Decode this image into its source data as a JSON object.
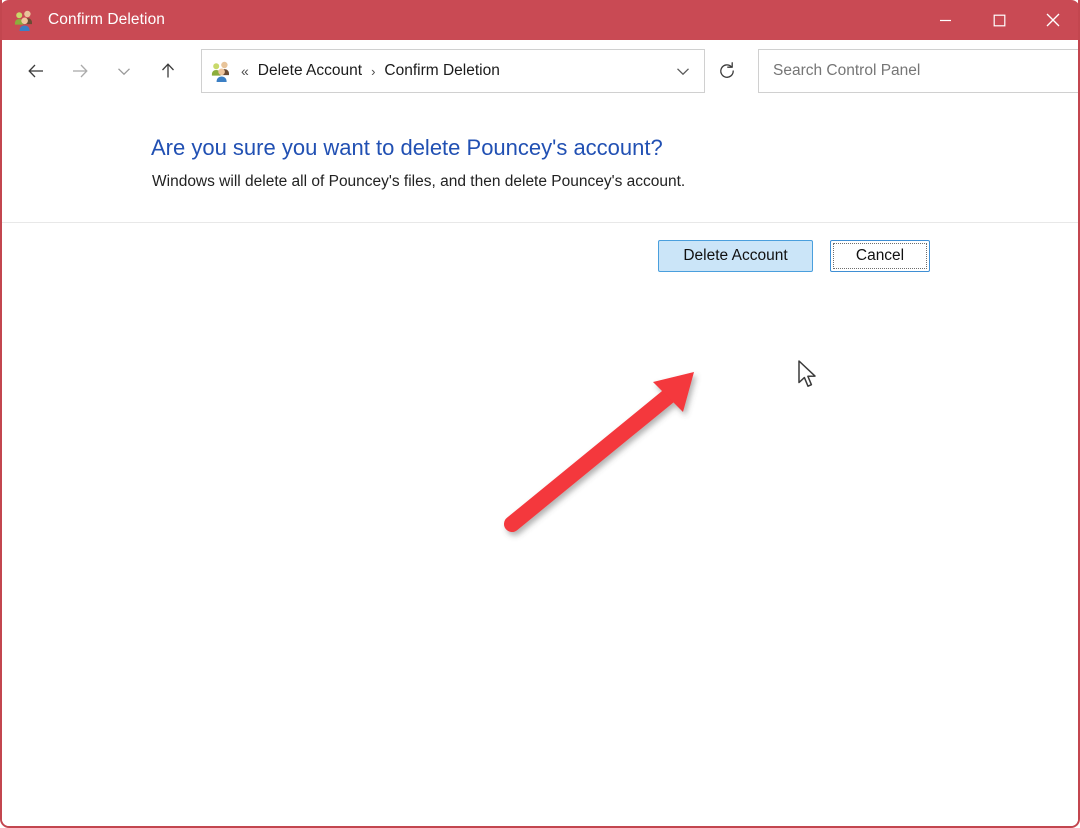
{
  "window": {
    "title": "Confirm Deletion",
    "title_icon": "user-accounts-icon",
    "titlebar_color": "#c94a54",
    "border_color": "#c3464f",
    "controls": {
      "minimize": "minimize-icon",
      "maximize": "maximize-icon",
      "close": "close-icon"
    }
  },
  "toolbar": {
    "nav": {
      "back": "back-arrow-icon",
      "forward": "forward-arrow-icon",
      "recent": "chevron-down-icon",
      "up": "up-arrow-icon"
    },
    "address": {
      "icon": "user-accounts-icon",
      "overflow": "«",
      "crumbs": [
        "Delete Account",
        "Confirm Deletion"
      ],
      "separator": "›",
      "dropdown": "chevron-down-icon",
      "refresh": "refresh-icon"
    },
    "search": {
      "placeholder": "Search Control Panel",
      "value": "",
      "icon": "search-icon"
    }
  },
  "main": {
    "heading": "Are you sure you want to delete Pouncey's account?",
    "heading_color": "#2150b3",
    "subtext": "Windows will delete all of Pouncey's files, and then delete Pouncey's account.",
    "buttons": {
      "delete": {
        "label": "Delete Account",
        "state": "hovered",
        "fill": "#cbe5f8",
        "border": "#4a9fdd"
      },
      "cancel": {
        "label": "Cancel",
        "state": "focused",
        "fill": "#ffffff",
        "border": "#3f8fd4"
      }
    }
  },
  "annotations": {
    "arrow": {
      "name": "red-pointer-arrow",
      "color": "#f4373c",
      "points_to": "Delete Account"
    },
    "cursor": {
      "name": "mouse-cursor",
      "type": "arrow-pointer"
    }
  }
}
